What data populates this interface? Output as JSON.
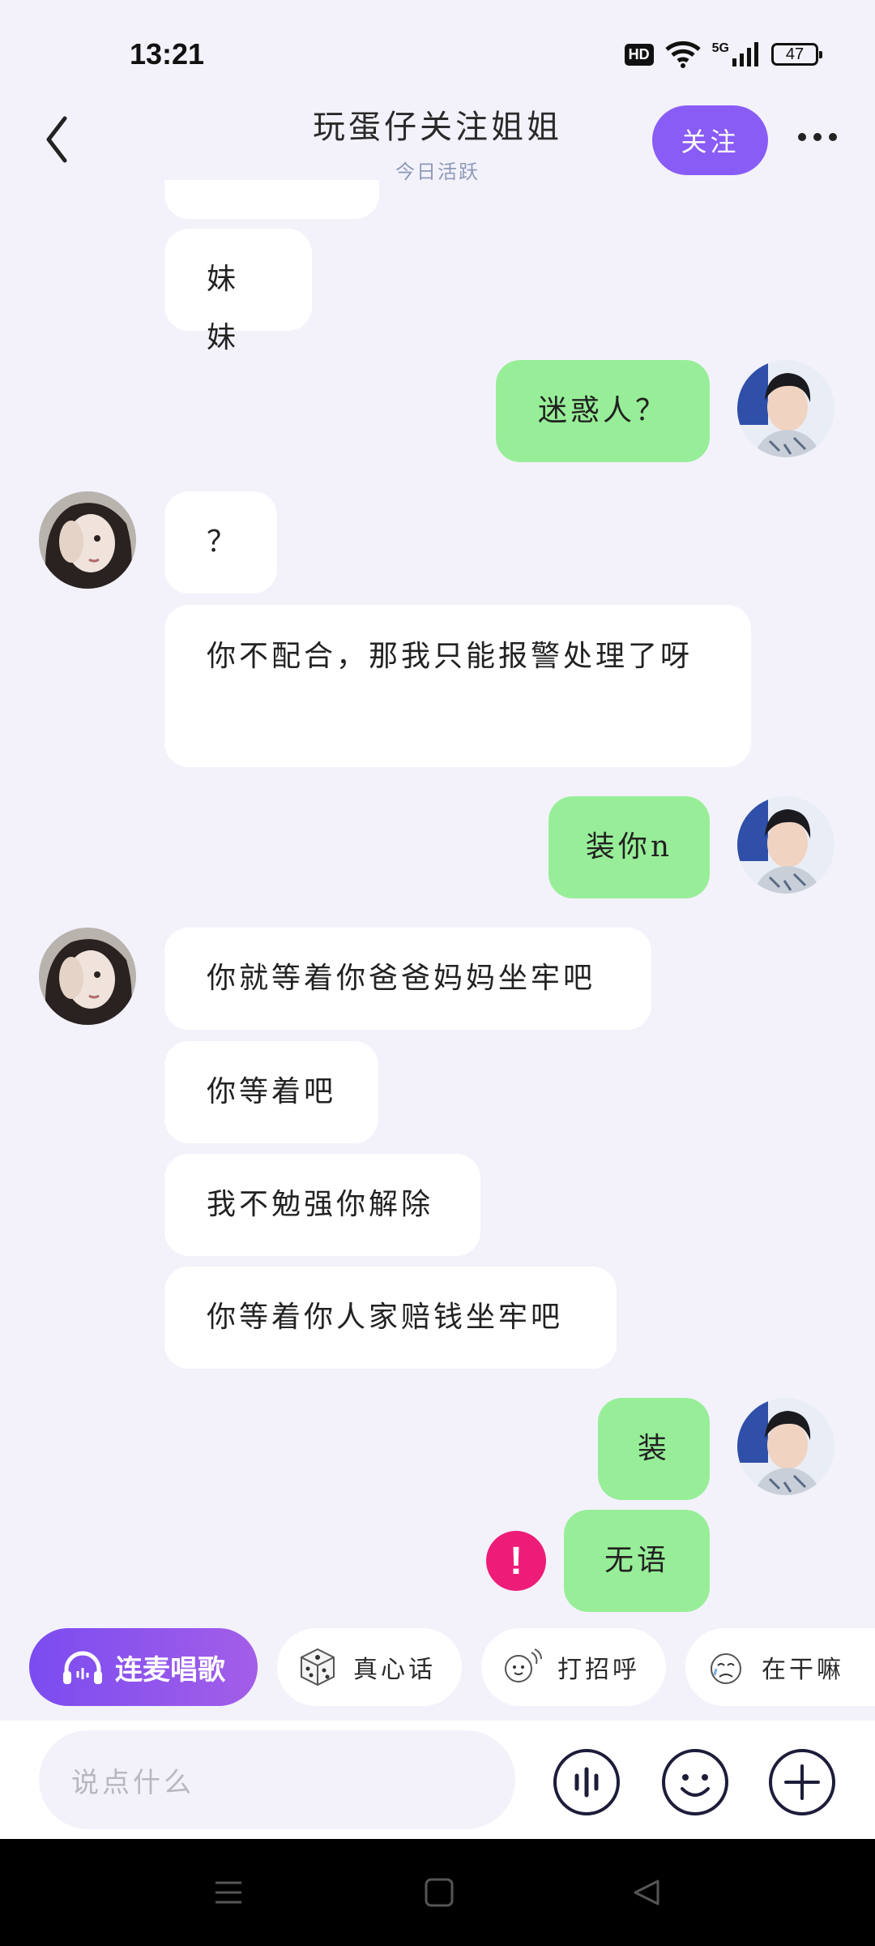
{
  "status_bar": {
    "time": "13:21",
    "hd": "HD",
    "network": "5G",
    "battery": "47"
  },
  "header": {
    "title": "玩蛋仔关注姐姐",
    "subtitle": "今日活跃",
    "follow_label": "关注"
  },
  "messages": [
    {
      "side": "in",
      "text": "妹妹"
    },
    {
      "side": "out",
      "text": "迷惑人？"
    },
    {
      "side": "in",
      "text": "？"
    },
    {
      "side": "in",
      "text": "你不配合，那我只能报警处理了呀"
    },
    {
      "side": "out",
      "text": "装你n"
    },
    {
      "side": "in",
      "text": "你就等着你爸爸妈妈坐牢吧"
    },
    {
      "side": "in",
      "text": "你等着吧"
    },
    {
      "side": "in",
      "text": "我不勉强你解除"
    },
    {
      "side": "in",
      "text": "你等着你人家赔钱坐牢吧"
    },
    {
      "side": "out",
      "text": "装"
    },
    {
      "side": "out",
      "text": "无语",
      "failed": true
    }
  ],
  "failed_mark": "!",
  "quick_bar": {
    "sing_label": "连麦唱歌",
    "chips": [
      "真心话",
      "打招呼",
      "在干嘛"
    ]
  },
  "input": {
    "placeholder": "说点什么"
  },
  "colors": {
    "background": "#f3f2fb",
    "accent": "#8a5cf6",
    "outgoing_bubble": "#98ee98",
    "incoming_bubble": "#ffffff",
    "error": "#ee1c79"
  },
  "icons": [
    "back-icon",
    "more-icon",
    "headphones-icon",
    "dice-icon",
    "wave-icon",
    "cry-icon",
    "voice-icon",
    "emoji-icon",
    "plus-icon",
    "menu-icon",
    "home-icon",
    "back-triangle-icon"
  ]
}
